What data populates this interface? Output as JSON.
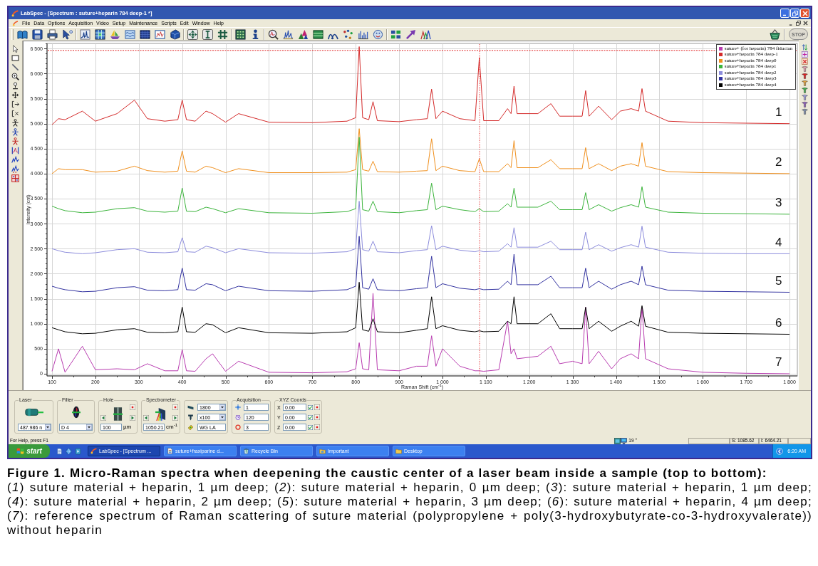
{
  "window": {
    "title": "LabSpec - [Spectrum : suture+heparin 784 deep-1 *]"
  },
  "menu": [
    "File",
    "Data",
    "Options",
    "Acquisition",
    "Video",
    "Setup",
    "Maintenance",
    "Scripts",
    "Edit",
    "Window",
    "Help"
  ],
  "toolbar": {
    "stop": {
      "label": "STOP",
      "disabled": true
    }
  },
  "spectrum": {
    "chart_data": {
      "type": "line",
      "xlabel": "Raman Shift (cm$^{-1}$)",
      "ylabel": "Intensity (cnt)",
      "grid": true,
      "legend": true,
      "x": [
        100,
        115,
        130,
        170,
        200,
        250,
        290,
        320,
        360,
        390,
        400,
        410,
        430,
        455,
        470,
        500,
        530,
        600,
        700,
        780,
        800,
        808,
        816,
        830,
        840,
        850,
        900,
        940,
        965,
        975,
        985,
        1000,
        1040,
        1075,
        1085,
        1095,
        1130,
        1150,
        1158,
        1165,
        1172,
        1220,
        1250,
        1270,
        1300,
        1322,
        1330,
        1338,
        1360,
        1390,
        1410,
        1435,
        1452,
        1460,
        1468,
        1520,
        1600,
        1700,
        1800
      ],
      "series": [
        {
          "name": "suture+ (for heparin) 784 fiducian",
          "color": "#b83cb0",
          "values": [
            50,
            500,
            30,
            550,
            80,
            100,
            80,
            200,
            60,
            60,
            480,
            60,
            50,
            300,
            400,
            50,
            250,
            30,
            20,
            40,
            100,
            620,
            100,
            80,
            1610,
            80,
            60,
            150,
            150,
            760,
            150,
            500,
            150,
            60,
            60,
            50,
            80,
            1050,
            400,
            500,
            300,
            350,
            550,
            200,
            250,
            200,
            1330,
            200,
            450,
            100,
            300,
            400,
            300,
            1330,
            300,
            100,
            30,
            10,
            0
          ]
        },
        {
          "name": "suture+heparin 784 deep-1",
          "color": "#d42a2a",
          "values": [
            4980,
            5100,
            5080,
            5250,
            5050,
            5200,
            5470,
            5100,
            5050,
            5080,
            5470,
            5080,
            5050,
            5250,
            5200,
            5030,
            5200,
            5030,
            5020,
            5050,
            5120,
            6540,
            5120,
            5080,
            5440,
            5060,
            5040,
            5080,
            5100,
            5690,
            5100,
            5250,
            5100,
            5060,
            6320,
            5060,
            5060,
            5300,
            5200,
            5750,
            5200,
            5200,
            5400,
            5150,
            5150,
            5150,
            5660,
            5150,
            5350,
            5080,
            5250,
            5300,
            5250,
            5700,
            5250,
            5050,
            5020,
            5010,
            5000
          ]
        },
        {
          "name": "suture+heparin 784 deep0",
          "color": "#f0901e",
          "values": [
            4000,
            4100,
            4080,
            4080,
            4030,
            4050,
            4150,
            4060,
            4030,
            4050,
            4450,
            4050,
            4030,
            4150,
            4120,
            4020,
            4100,
            4020,
            4020,
            4030,
            4080,
            4900,
            4080,
            4050,
            4250,
            4040,
            4030,
            4050,
            4060,
            4700,
            4060,
            4150,
            4060,
            4040,
            4300,
            4040,
            4040,
            4200,
            4120,
            4660,
            4120,
            4120,
            4280,
            4100,
            4100,
            4100,
            4520,
            4100,
            4200,
            4060,
            4150,
            4200,
            4150,
            4620,
            4150,
            4040,
            4020,
            4010,
            4000
          ]
        },
        {
          "name": "suture+heparin 784 deep1",
          "color": "#3cb43c",
          "values": [
            3350,
            3300,
            3260,
            3220,
            3230,
            3300,
            3320,
            3250,
            3230,
            3250,
            3710,
            3250,
            3240,
            3330,
            3300,
            3220,
            3300,
            3220,
            3210,
            3240,
            3300,
            4730,
            3280,
            3250,
            3450,
            3240,
            3220,
            3260,
            3280,
            3810,
            3280,
            3350,
            3280,
            3240,
            3300,
            3240,
            3250,
            3400,
            3330,
            3710,
            3330,
            3330,
            3450,
            3280,
            3280,
            3280,
            3620,
            3280,
            3380,
            3250,
            3320,
            3380,
            3330,
            3740,
            3330,
            3230,
            3210,
            3200,
            3190
          ]
        },
        {
          "name": "suture+heparin 784 deep2",
          "color": "#8c8cdc",
          "values": [
            2500,
            2460,
            2430,
            2400,
            2420,
            2480,
            2500,
            2430,
            2420,
            2440,
            2720,
            2440,
            2430,
            2550,
            2520,
            2420,
            2500,
            2420,
            2410,
            2440,
            2500,
            3450,
            2480,
            2450,
            2650,
            2440,
            2420,
            2460,
            2480,
            2960,
            2480,
            2550,
            2470,
            2440,
            2460,
            2440,
            2450,
            2600,
            2530,
            2920,
            2530,
            2530,
            2650,
            2480,
            2480,
            2480,
            2830,
            2480,
            2580,
            2450,
            2520,
            2580,
            2530,
            2950,
            2530,
            2430,
            2410,
            2400,
            2400
          ]
        },
        {
          "name": "suture+heparin 784 deep3",
          "color": "#3232a0",
          "values": [
            1750,
            1710,
            1680,
            1640,
            1650,
            1720,
            1740,
            1670,
            1660,
            1680,
            2110,
            1680,
            1670,
            1800,
            1780,
            1660,
            1750,
            1660,
            1650,
            1680,
            1750,
            2750,
            1720,
            1690,
            1900,
            1680,
            1660,
            1700,
            1720,
            2350,
            1720,
            1800,
            1710,
            1680,
            1700,
            1680,
            1690,
            1850,
            1780,
            2390,
            1780,
            1780,
            1950,
            1720,
            1720,
            1720,
            2110,
            1720,
            1850,
            1690,
            1780,
            1850,
            1780,
            2150,
            1780,
            1670,
            1650,
            1640,
            1630
          ]
        },
        {
          "name": "suture+heparin 784 deep4",
          "color": "#000000",
          "values": [
            920,
            880,
            840,
            800,
            810,
            880,
            900,
            830,
            820,
            840,
            1330,
            840,
            830,
            1000,
            980,
            820,
            920,
            820,
            810,
            840,
            920,
            1830,
            880,
            850,
            1100,
            840,
            820,
            870,
            900,
            1540,
            900,
            960,
            870,
            840,
            860,
            840,
            850,
            1050,
            1000,
            1540,
            1000,
            1000,
            1200,
            900,
            900,
            900,
            1330,
            900,
            1050,
            850,
            950,
            1050,
            950,
            1360,
            950,
            830,
            810,
            800,
            790
          ]
        }
      ],
      "xlim": [
        88.5,
        1818
      ],
      "ylim": [
        -43,
        6604
      ],
      "xticks": [
        100,
        200,
        300,
        400,
        500,
        600,
        700,
        800,
        900,
        {
          "value": 1000,
          "label": "1 000"
        },
        {
          "value": 1100,
          "label": "1 100"
        },
        {
          "value": 1200,
          "label": "1 200"
        },
        {
          "value": 1300,
          "label": "1 300"
        },
        {
          "value": 1400,
          "label": "1 400"
        },
        {
          "value": 1500,
          "label": "1 500"
        },
        {
          "value": 1600,
          "label": "1 600"
        },
        {
          "value": 1700,
          "label": "1 700"
        },
        {
          "value": 1800,
          "label": "1 800"
        }
      ],
      "yticks": [
        0,
        500,
        {
          "value": 1000,
          "label": "1 000"
        },
        {
          "value": 1500,
          "label": "1 500"
        },
        {
          "value": 2000,
          "label": "2 000"
        },
        {
          "value": 2500,
          "label": "2 500"
        },
        {
          "value": 3000,
          "label": "3 000"
        },
        {
          "value": 3500,
          "label": "3 500"
        },
        {
          "value": 4000,
          "label": "4 000"
        },
        {
          "value": 4500,
          "label": "4 500"
        },
        {
          "value": 5000,
          "label": "5 000"
        },
        {
          "value": 5500,
          "label": "5 500"
        },
        {
          "value": 6000,
          "label": "6 000"
        },
        {
          "value": 6500,
          "label": "6 500"
        }
      ],
      "ref_lines": [
        {
          "axis": "y",
          "value": 6464.21
        },
        {
          "axis": "x",
          "value": 1085.62
        }
      ],
      "annotations": [
        "1",
        "2",
        "3",
        "4",
        "5",
        "6",
        "7"
      ]
    }
  },
  "controls": {
    "laser": {
      "title": "Laser",
      "value": "487.986 n"
    },
    "filter": {
      "title": "Filter",
      "value": "D 4"
    },
    "hole": {
      "title": "Hole",
      "value": "100",
      "unit": "µm"
    },
    "spectrometer": {
      "title": "Spectrometer",
      "value": "1050.21",
      "unit": "cm$^{-1}$"
    },
    "optics": [
      {
        "kind": "dropdown",
        "value": "1800"
      },
      {
        "kind": "dropdown",
        "value": "x100"
      },
      {
        "kind": "field",
        "value": "WG LA"
      }
    ],
    "acquisition": {
      "title": "Acquisition",
      "fields": [
        "1",
        "120",
        "3"
      ]
    },
    "xyz_coords": {
      "title": "XYZ Coords",
      "axes": [
        {
          "label": "X",
          "value": "0.00",
          "checked": true
        },
        {
          "label": "Y",
          "value": "0.00",
          "checked": true
        },
        {
          "label": "Z",
          "value": "0.00",
          "checked": true
        }
      ]
    }
  },
  "status_bar": {
    "help": "For Help, press F1",
    "angle": "19 °",
    "readouts": [
      "S: 1085.62",
      "I: 6464.21"
    ]
  },
  "taskbar": {
    "start": "start",
    "tasks": [
      {
        "label": "LabSpec - [Spectrum ...",
        "selected": true
      },
      {
        "label": "suture+fraxiparine d...",
        "selected": false
      },
      {
        "label": "Recycle Bin",
        "selected": false
      },
      {
        "label": "Important",
        "selected": false
      },
      {
        "label": "Desktop",
        "selected": false
      }
    ],
    "clock": "6:20 AM"
  },
  "caption": {
    "title": "Figure 1. Micro-Raman spectra when deepening the caustic center of a laser beam inside a sample (top to bottom):",
    "text": "(*1*) suture material + heparin, 1 µm deep; (*2*): suture material + heparin, 0 µm deep; (*3*): suture material + heparin, 1 µm deep; (*4*): suture material + heparin, 2 µm deep; (*5*): suture material + heparin, 3 µm deep; (*6*): suture material + heparin, 4 µm deep; (*7*): reference spectrum of Raman scattering of suture material (polypropylene + poly(3-hydroxybutyrate-co-3-hydroxyvalerate)) without heparin"
  }
}
